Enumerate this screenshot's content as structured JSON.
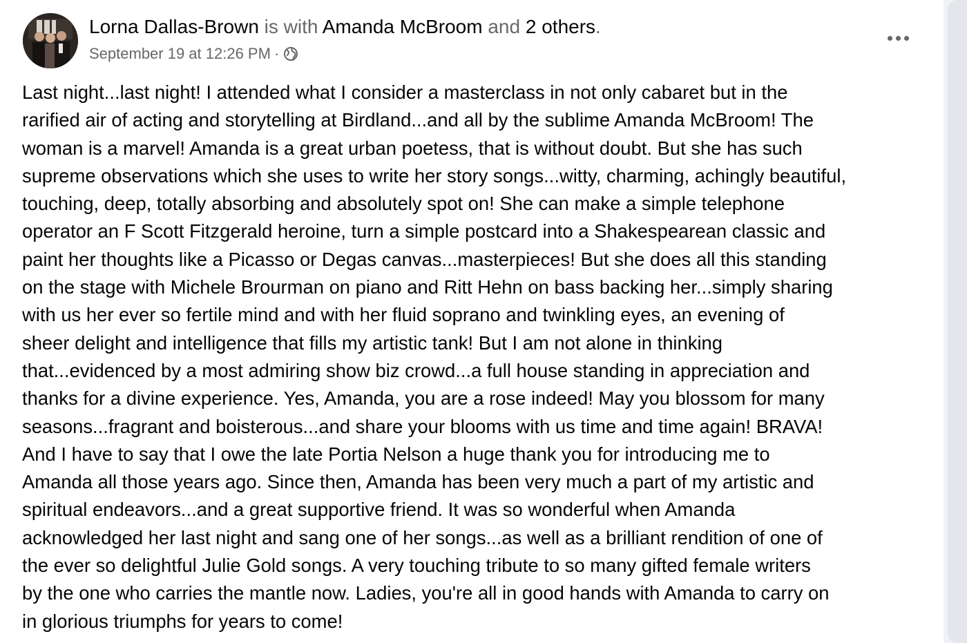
{
  "post": {
    "author": "Lorna Dallas-Brown",
    "with_text": "is with",
    "tagged_person": "Amanda McBroom",
    "and_text": "and",
    "others": "2 others",
    "period": ".",
    "timestamp": "September 19 at 12:26 PM",
    "separator": "·",
    "privacy_icon": "globe-icon",
    "more_icon": "more-horizontal-icon",
    "body_lines": [
      "Last night...last night!  I attended what I consider a masterclass in not only cabaret but in the",
      "rarified air of acting and storytelling at Birdland...and all by the sublime Amanda McBroom!  The",
      "woman is a marvel!  Amanda is a great urban poetess, that is without doubt.  But she has such",
      "supreme observations which she uses to write her story songs...witty, charming, achingly beautiful,",
      "touching, deep, totally absorbing and absolutely spot on!  She can make a simple telephone",
      "operator an F Scott Fitzgerald heroine, turn a simple postcard into a Shakespearean classic and",
      "paint her thoughts like a Picasso or Degas canvas...masterpieces!  But she does all this standing",
      "on the stage with Michele Brourman on piano and Ritt Hehn on bass backing her...simply sharing",
      "with us her ever so fertile mind and  with her fluid soprano and twinkling eyes, an evening of",
      "sheer delight and intelligence that fills my artistic tank!  But I am not alone in thinking",
      "that...evidenced by a most admiring show biz crowd...a full house standing in appreciation and",
      "thanks for a divine experience. Yes, Amanda, you are a rose indeed!  May you blossom for many",
      "seasons...fragrant and boisterous...and share your blooms with us time and time again!  BRAVA!",
      "And I have to say that I owe the late Portia Nelson a huge thank you for introducing me to",
      "Amanda all those years ago.  Since then, Amanda has been very much a part of my artistic and",
      "spiritual endeavors...and a great supportive friend.  It was so wonderful when Amanda",
      "acknowledged her last night and sang one of her songs...as well as a brilliant rendition of one of",
      "the ever so delightful Julie Gold songs.  A very touching tribute to so many gifted female writers",
      "by the one who carries the mantle now.  Ladies, you're all in good hands with Amanda to carry on",
      "in glorious triumphs for years to come!"
    ]
  },
  "colors": {
    "primary_text": "#050505",
    "secondary_text": "#65676b",
    "background": "#ffffff",
    "gutter": "#f0f2f5"
  }
}
